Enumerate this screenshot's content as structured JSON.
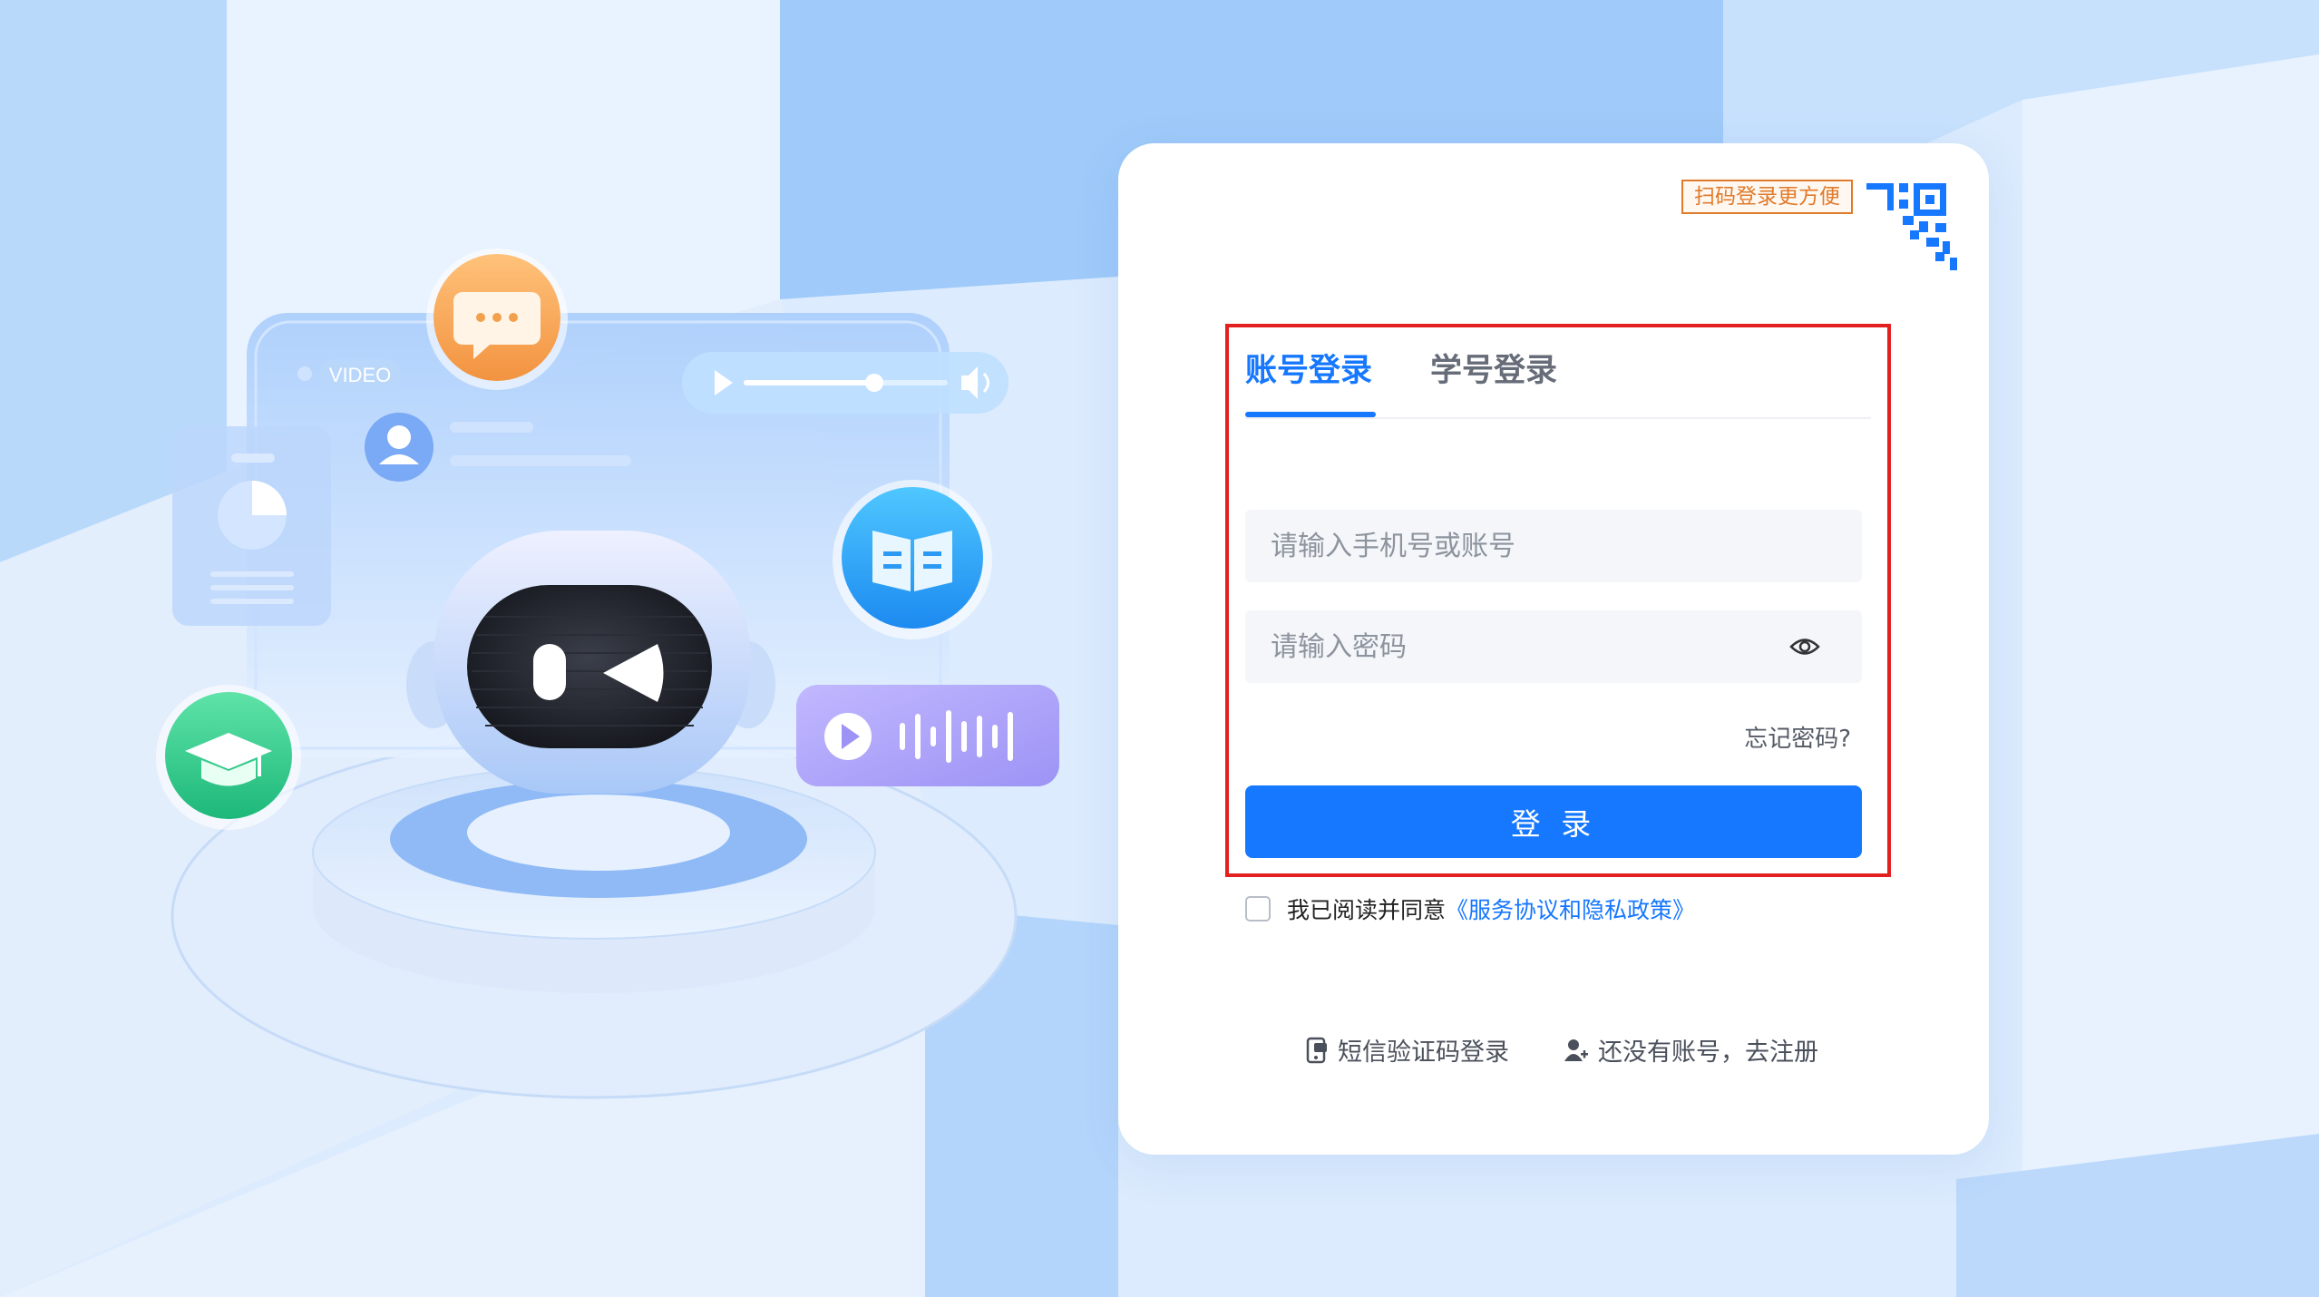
{
  "login": {
    "qr_badge": "扫码登录更方便",
    "tabs": [
      {
        "label": "账号登录",
        "active": true
      },
      {
        "label": "学号登录",
        "active": false
      }
    ],
    "account_placeholder": "请输入手机号或账号",
    "password_placeholder": "请输入密码",
    "forgot_password": "忘记密码?",
    "login_button": "登 录",
    "agree_text": "我已阅读并同意",
    "agree_link": "《服务协议和隐私政策》",
    "sms_login": "短信验证码登录",
    "register": "还没有账号，去注册"
  },
  "illustration": {
    "video_label": "VIDEO"
  },
  "colors": {
    "primary": "#1677ff",
    "highlight_border": "#e32020",
    "qr_badge": "#e07a2b",
    "background": "#dcebfd"
  },
  "icons": [
    "qr-code-icon",
    "eye-icon",
    "sms-phone-icon",
    "add-user-icon",
    "chat-bubble-icon",
    "book-icon",
    "graduation-cap-icon",
    "play-icon",
    "audio-wave-icon",
    "robot-mascot"
  ]
}
